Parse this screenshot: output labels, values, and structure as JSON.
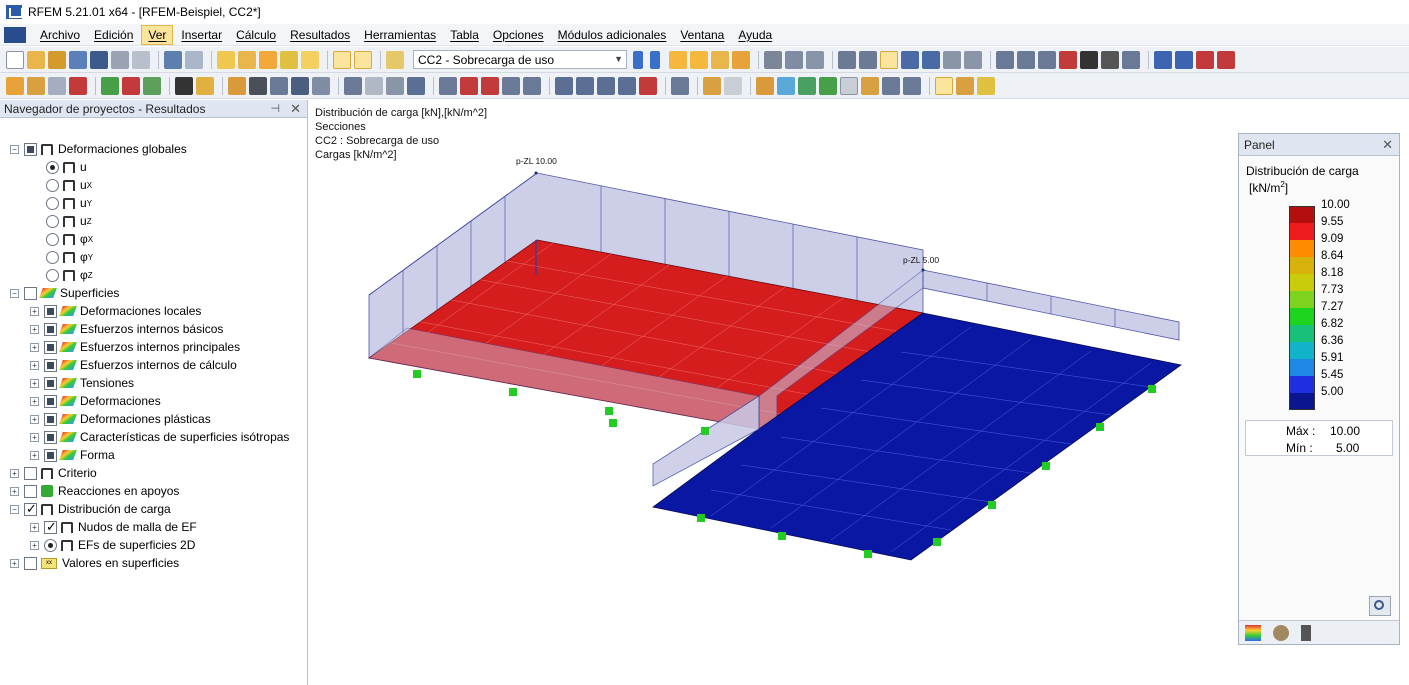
{
  "window": {
    "title": "RFEM 5.21.01 x64 - [RFEM-Beispiel, CC2*]"
  },
  "menu": {
    "items": [
      "Archivo",
      "Edición",
      "Ver",
      "Insertar",
      "Cálculo",
      "Resultados",
      "Herramientas",
      "Tabla",
      "Opciones",
      "Módulos adicionales",
      "Ventana",
      "Ayuda"
    ],
    "active": "Ver"
  },
  "toolbar": {
    "load_case": "CC2 - Sobrecarga de uso"
  },
  "navigator": {
    "title": "Navegador de proyectos - Resultados",
    "pin": "⊣",
    "close": "✕",
    "global_deformations": "Deformaciones globales",
    "deformation_items": [
      {
        "label": "u",
        "sub": ""
      },
      {
        "label": "u",
        "sub": "X"
      },
      {
        "label": "u",
        "sub": "Y"
      },
      {
        "label": "u",
        "sub": "Z"
      },
      {
        "label": "φ",
        "sub": "X"
      },
      {
        "label": "φ",
        "sub": "Y"
      },
      {
        "label": "φ",
        "sub": "Z"
      }
    ],
    "surfaces": "Superficies",
    "surface_items": [
      "Deformaciones locales",
      "Esfuerzos internos básicos",
      "Esfuerzos internos principales",
      "Esfuerzos internos de cálculo",
      "Tensiones",
      "Deformaciones",
      "Deformaciones plásticas",
      "Características de superficies isótropas",
      "Forma"
    ],
    "criterion": "Criterio",
    "support_reactions": "Reacciones en apoyos",
    "load_distribution": "Distribución de carga",
    "load_items": [
      "Nudos de malla de EF",
      "EFs de superficies 2D"
    ],
    "surface_values": "Valores en superficies",
    "surface_values_icon": "xx"
  },
  "viewport": {
    "info_lines": [
      "Distribución de carga [kN],[kN/m^2]",
      "Secciones",
      "CC2 : Sobrecarga de uso",
      "Cargas [kN/m^2]"
    ],
    "label_high": "p-ZL 10.00",
    "label_low": "p-ZL 5.00",
    "colors": {
      "high": "#d51d1d",
      "low": "#0a17a3",
      "wall": "#c7c9e8",
      "support": "#22cc22"
    }
  },
  "panel": {
    "title": "Panel",
    "close": "✕",
    "result_title": "Distribución de carga",
    "unit": "[kN/m",
    "unit_exp": "2",
    "unit_end": "]",
    "legend": [
      {
        "value": "10.00",
        "color": "#b30f0f"
      },
      {
        "value": "9.55",
        "color": "#ee1c1c"
      },
      {
        "value": "9.09",
        "color": "#ff8c00"
      },
      {
        "value": "8.64",
        "color": "#d8b20a"
      },
      {
        "value": "8.18",
        "color": "#c9cc0a"
      },
      {
        "value": "7.73",
        "color": "#7ed321"
      },
      {
        "value": "7.27",
        "color": "#1ed41e"
      },
      {
        "value": "6.82",
        "color": "#19c07a"
      },
      {
        "value": "6.36",
        "color": "#11b3c8"
      },
      {
        "value": "5.91",
        "color": "#1e88e5"
      },
      {
        "value": "5.45",
        "color": "#1f2fe0"
      },
      {
        "value": "5.00",
        "color": "#0b1590"
      }
    ],
    "max_label": "Máx :",
    "max_value": "10.00",
    "min_label": "Mín :",
    "min_value": "5.00"
  }
}
